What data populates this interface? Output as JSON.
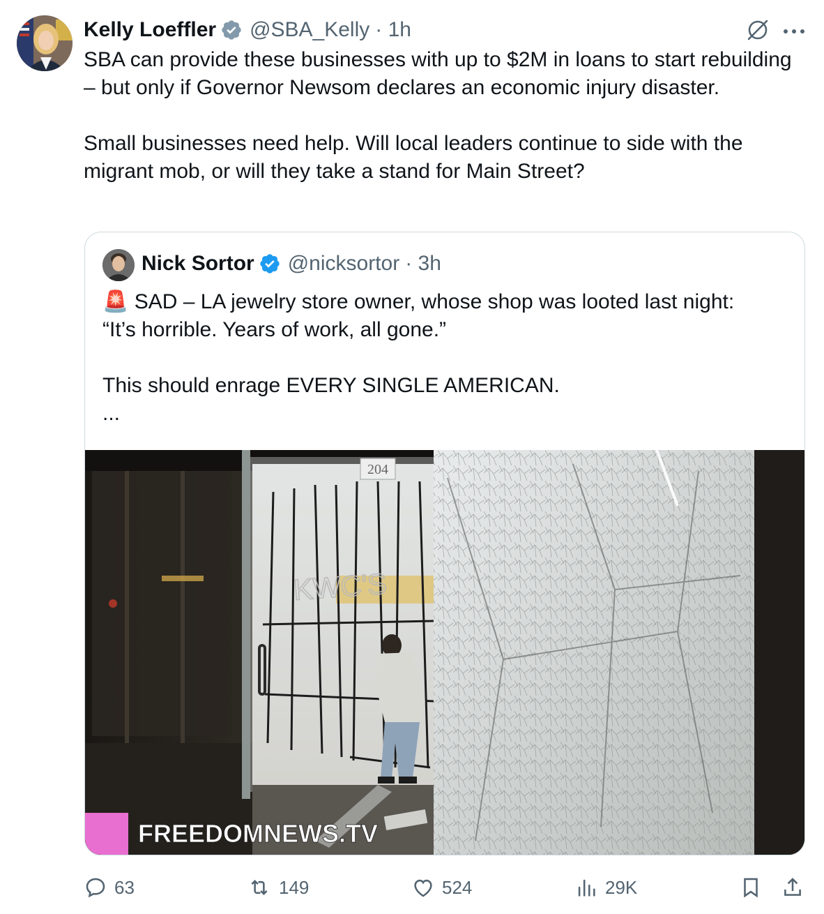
{
  "tweet": {
    "author_name": "Kelly Loeffler",
    "author_handle": "@SBA_Kelly",
    "timestamp": "· 1h",
    "paragraphs": [
      "SBA can provide these businesses with up to $2M in loans to start rebuilding – but only if Governor Newsom declares an economic injury disaster.",
      "Small businesses need help. Will local leaders continue to side with the migrant mob, or will they take a stand for Main Street?"
    ]
  },
  "quoted_tweet": {
    "author_name": "Nick Sortor",
    "author_handle": "@nicksortor",
    "timestamp": "· 3h",
    "line1_emoji": "🚨",
    "line1": "SAD – LA jewelry store owner, whose shop was looted last night:",
    "line2": "“It’s horrible. Years of work, all gone.”",
    "line3": "This should enrage EVERY SINGLE AMERICAN.",
    "ellipsis": "...",
    "media": {
      "watermark": "FREEDOMNEWS.TV",
      "storefront_number": "204",
      "storefront_sign": "KWC'S"
    }
  },
  "actions": {
    "replies": "63",
    "reposts": "149",
    "likes": "524",
    "views": "29K"
  },
  "colors": {
    "text_primary": "#0f1419",
    "text_secondary": "#536471",
    "verified_blue": "#1d9bf0",
    "border": "#cfd9de",
    "watermark_pink": "#e86fd0"
  },
  "icons": [
    "verified-badge-icon",
    "grok-icon",
    "more-icon",
    "reply-icon",
    "repost-icon",
    "like-icon",
    "views-icon",
    "bookmark-icon",
    "share-icon"
  ]
}
